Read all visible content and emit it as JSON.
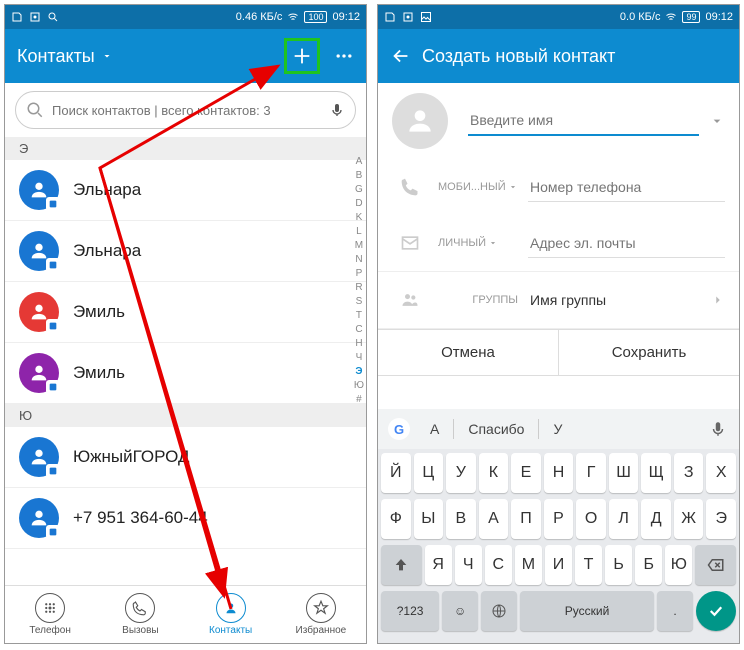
{
  "status": {
    "data1": "0.46 КБ/с",
    "data2": "0.0 КБ/с",
    "battery": "100",
    "battery2": "99",
    "time": "09:12"
  },
  "phone1": {
    "title": "Контакты",
    "search_placeholder": "Поиск контактов | всего контактов: 3",
    "sections": [
      {
        "letter": "Э",
        "contacts": [
          {
            "name": "Эльнара",
            "color": "#1976d2"
          },
          {
            "name": "Эльнара",
            "color": "#1976d2"
          },
          {
            "name": "Эмиль",
            "color": "#e53935"
          },
          {
            "name": "Эмиль",
            "color": "#8e24aa"
          }
        ]
      },
      {
        "letter": "Ю",
        "contacts": [
          {
            "name": "ЮжныйГОРОД",
            "color": "#1976d2"
          }
        ]
      },
      {
        "letter": "",
        "contacts": [
          {
            "name": "+7 951 364-60-44",
            "color": "#1976d2"
          }
        ]
      }
    ],
    "index": [
      "A",
      "B",
      "G",
      "D",
      "K",
      "L",
      "M",
      "N",
      "P",
      "R",
      "S",
      "T",
      "C",
      "H",
      "Ч",
      "Э",
      "Ю",
      "#"
    ],
    "index_active": "Э",
    "nav": [
      {
        "label": "Телефон",
        "id": "phone"
      },
      {
        "label": "Вызовы",
        "id": "calls"
      },
      {
        "label": "Контакты",
        "id": "contacts"
      },
      {
        "label": "Избранное",
        "id": "fav"
      }
    ],
    "nav_active": 2
  },
  "phone2": {
    "title": "Создать новый контакт",
    "name_placeholder": "Введите имя",
    "phone_label": "МОБИ...НЫЙ",
    "phone_placeholder": "Номер телефона",
    "email_label": "ЛИЧНЫЙ",
    "email_placeholder": "Адрес эл. почты",
    "group_label": "ГРУППЫ",
    "group_placeholder": "Имя группы",
    "cancel": "Отмена",
    "save": "Сохранить",
    "suggestions": [
      "А",
      "Спасибо",
      "У"
    ],
    "keyboard": {
      "row1": [
        "Й",
        "Ц",
        "У",
        "К",
        "Е",
        "Н",
        "Г",
        "Ш",
        "Щ",
        "З",
        "Х"
      ],
      "row2": [
        "Ф",
        "Ы",
        "В",
        "А",
        "П",
        "Р",
        "О",
        "Л",
        "Д",
        "Ж",
        "Э"
      ],
      "row3": [
        "Я",
        "Ч",
        "С",
        "М",
        "И",
        "Т",
        "Ь",
        "Б",
        "Ю"
      ],
      "numkey": "?123",
      "space": "Русский"
    }
  }
}
